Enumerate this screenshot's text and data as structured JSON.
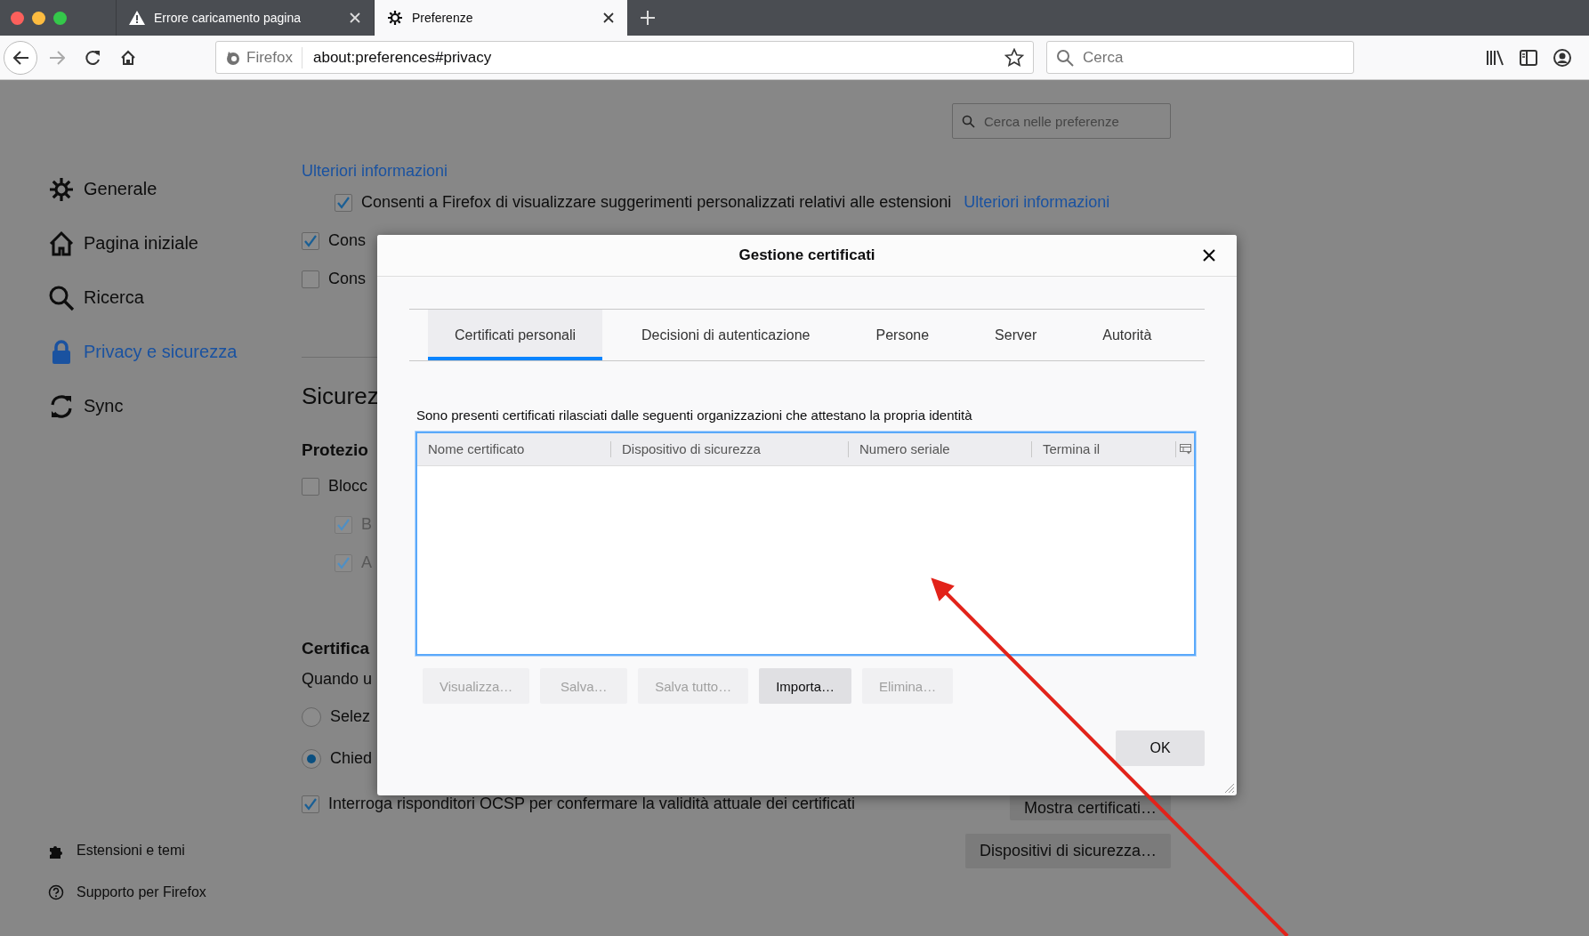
{
  "browser": {
    "tabs": [
      {
        "title": "Errore caricamento pagina",
        "selected": false
      },
      {
        "title": "Preferenze",
        "selected": true
      }
    ],
    "url_bar": {
      "identity": "Firefox",
      "value": "about:preferences#privacy"
    },
    "search": {
      "placeholder": "Cerca"
    }
  },
  "preferences": {
    "search": {
      "placeholder": "Cerca nelle preferenze"
    },
    "sidebar": {
      "items": [
        {
          "label": "Generale",
          "selected": false
        },
        {
          "label": "Pagina iniziale",
          "selected": false
        },
        {
          "label": "Ricerca",
          "selected": false
        },
        {
          "label": "Privacy e sicurezza",
          "selected": true
        },
        {
          "label": "Sync",
          "selected": false
        }
      ],
      "footer": [
        {
          "label": "Estensioni e temi"
        },
        {
          "label": "Supporto per Firefox"
        }
      ]
    },
    "content": {
      "rows": [
        {
          "kind": "link",
          "text": "Ulteriori informazioni",
          "children": [
            {
              "kind": "checkbox",
              "label": "Consenti a Firefox di visualizzare suggerimenti personalizzati relativi alle estensioni",
              "link": "Ulteriori informazioni",
              "checked": true,
              "disabled": false
            }
          ]
        },
        {
          "kind": "checkbox",
          "label": "Cons",
          "checked": true,
          "disabled": false
        },
        {
          "kind": "checkbox",
          "label": "Cons",
          "checked": false,
          "disabled": false
        },
        {
          "kind": "divider"
        },
        {
          "kind": "title",
          "text": "Sicurez"
        },
        {
          "kind": "heading",
          "text": "Protezio"
        },
        {
          "kind": "checkbox",
          "label": "Blocc",
          "checked": false,
          "disabled": false,
          "children": [
            {
              "kind": "checkbox",
              "label": "B",
              "checked": true,
              "disabled": true
            },
            {
              "kind": "checkbox",
              "label": "A",
              "checked": true,
              "disabled": true
            }
          ]
        },
        {
          "kind": "heading",
          "text": "Certifica"
        },
        {
          "kind": "text",
          "text": "Quando u"
        },
        {
          "kind": "radio",
          "label": "Selez",
          "selected": false
        },
        {
          "kind": "radio",
          "label": "Chied",
          "selected": true
        },
        {
          "kind": "checkbox",
          "label": "Interroga risponditori OCSP per confermare la validità attuale dei certificati",
          "checked": true,
          "disabled": false,
          "button": "Mostra certificati…"
        },
        {
          "kind": "button",
          "label": "Dispositivi di sicurezza…"
        }
      ]
    }
  },
  "dialog": {
    "title": "Gestione certificati",
    "tabs": [
      {
        "label": "Certificati personali",
        "selected": true
      },
      {
        "label": "Decisioni di autenticazione",
        "selected": false
      },
      {
        "label": "Persone",
        "selected": false
      },
      {
        "label": "Server",
        "selected": false
      },
      {
        "label": "Autorità",
        "selected": false
      }
    ],
    "description": "Sono presenti certificati rilasciati dalle seguenti organizzazioni che attestano la propria identità",
    "table": {
      "columns": [
        "Nome certificato",
        "Dispositivo di sicurezza",
        "Numero seriale",
        "Termina il"
      ]
    },
    "buttons": [
      {
        "label": "Visualizza…",
        "disabled": true
      },
      {
        "label": "Salva…",
        "disabled": true
      },
      {
        "label": "Salva tutto…",
        "disabled": true
      },
      {
        "label": "Importa…",
        "disabled": false
      },
      {
        "label": "Elimina…",
        "disabled": true
      }
    ],
    "ok": "OK"
  }
}
